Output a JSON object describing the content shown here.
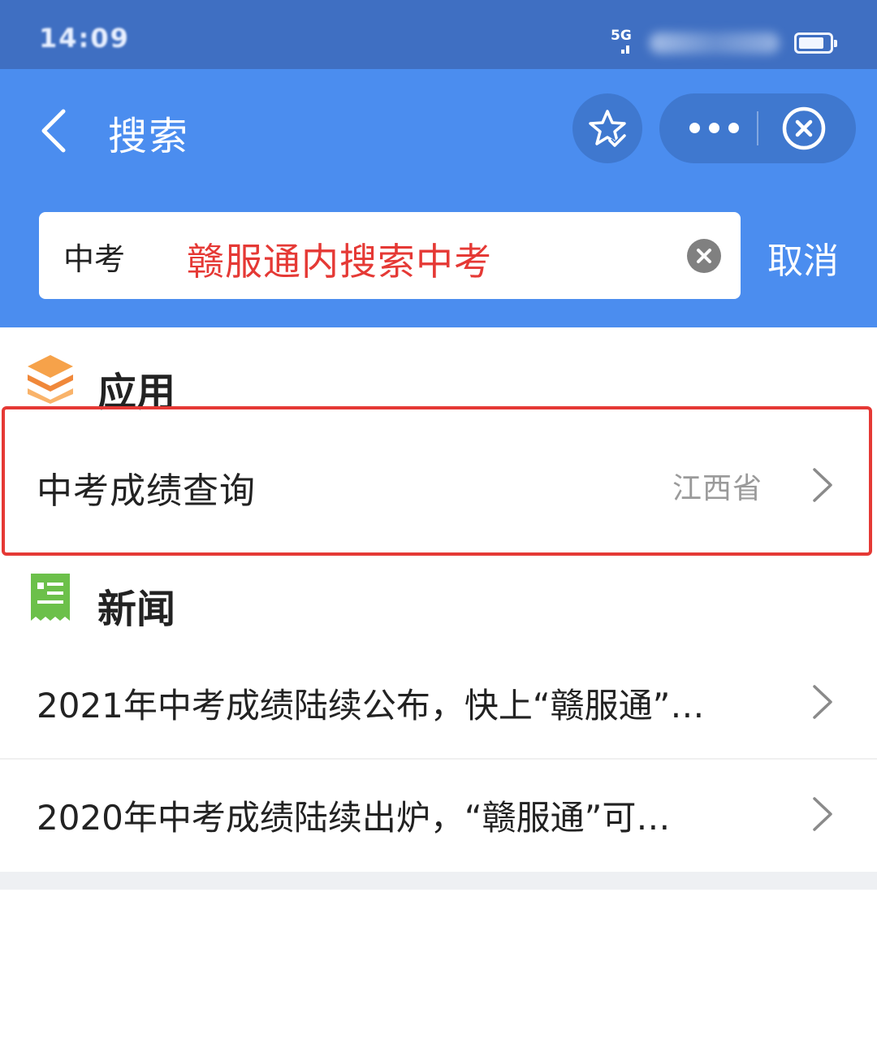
{
  "status_bar": {
    "time": "14:09",
    "network": "5G",
    "colors": {
      "background": "#3f6fc2"
    }
  },
  "nav_bar": {
    "title": "搜索",
    "icons": {
      "back": "chevron-left-icon",
      "favorite": "star-check-icon",
      "more": "more-dots-icon",
      "close": "close-circle-icon"
    },
    "colors": {
      "background": "#4b8def"
    }
  },
  "search": {
    "value": "中考",
    "annotation": "赣服通内搜索中考",
    "cancel_label": "取消",
    "clear_icon": "clear-icon"
  },
  "sections": {
    "apps": {
      "title": "应用",
      "icon": "layers-icon",
      "items": [
        {
          "label": "中考成绩查询",
          "region": "江西省"
        }
      ]
    },
    "news": {
      "title": "新闻",
      "icon": "news-icon",
      "items": [
        {
          "label": "2021年中考成绩陆续公布，快上“赣服通”…"
        },
        {
          "label": "2020年中考成绩陆续出炉，“赣服通”可…"
        }
      ]
    }
  },
  "colors": {
    "highlight": "#e53935",
    "apps_icon": "#f0883a",
    "news_icon": "#6cc04a"
  }
}
